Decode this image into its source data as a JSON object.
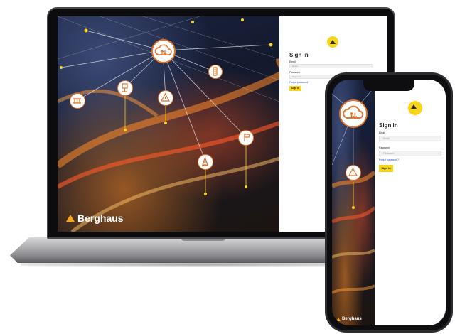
{
  "laptop": {
    "brand": "Berghaus",
    "login": {
      "title": "Sign in",
      "email_label": "Email",
      "email_placeholder": "Email",
      "password_label": "Password",
      "password_placeholder": "Password",
      "forgot_link": "Forgot password?",
      "signin_button": "Sign in"
    }
  },
  "phone": {
    "brand": "Berghaus",
    "login": {
      "title": "Sign in",
      "email_label": "Email",
      "email_placeholder": "Email",
      "password_label": "Password",
      "password_placeholder": "Password",
      "forgot_link": "Forgot password?",
      "signin_button": "Sign in"
    }
  },
  "icons": [
    "cloud-sync-icon",
    "traffic-light-icon",
    "railing-icon",
    "sensor-icon",
    "warning-icon",
    "traffic-cone-icon",
    "signpost-icon",
    "house-icon"
  ],
  "colors": {
    "accent": "#f7d518",
    "brand_triangle": "#f6a51e",
    "link": "#2a4fc7",
    "icon_orange": "#e0722a"
  }
}
